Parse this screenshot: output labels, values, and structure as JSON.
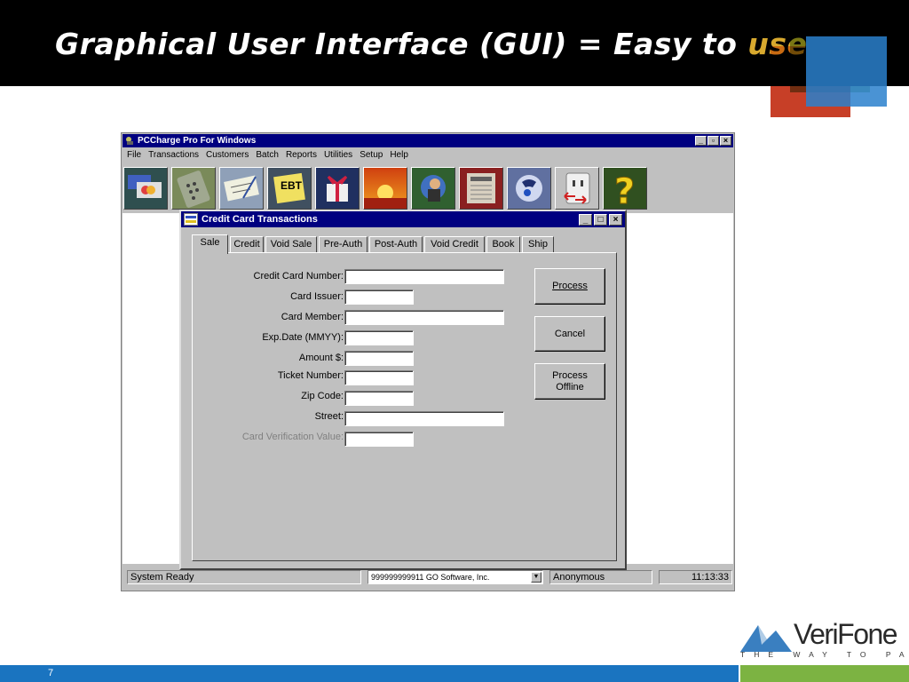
{
  "slide": {
    "title": "Graphical User Interface (GUI) = Easy to use",
    "page_number": "7",
    "logo_text": "VeriFone",
    "logo_tagline": "THE WAY TO PAY™"
  },
  "window": {
    "title": "PCCharge Pro For Windows",
    "menu": [
      "File",
      "Transactions",
      "Customers",
      "Batch",
      "Reports",
      "Utilities",
      "Setup",
      "Help"
    ],
    "toolbar_icons": [
      "credit-cards-icon",
      "calculator-icon",
      "check-icon",
      "ebt-icon",
      "gift-icon",
      "sunset-icon",
      "customer-icon",
      "reports-icon",
      "phone-icon",
      "plug-icon",
      "help-icon"
    ],
    "ebt_label": "EBT",
    "help_glyph": "?"
  },
  "dialog": {
    "title": "Credit Card Transactions",
    "tabs": [
      "Sale",
      "Credit",
      "Void Sale",
      "Pre-Auth",
      "Post-Auth",
      "Void Credit",
      "Book",
      "Ship"
    ],
    "active_tab": "Sale",
    "fields": [
      {
        "label": "Credit Card Number:",
        "value": ""
      },
      {
        "label": "Card Issuer:",
        "value": ""
      },
      {
        "label": "Card Member:",
        "value": ""
      },
      {
        "label": "Exp.Date (MMYY):",
        "value": ""
      },
      {
        "label": "Amount $:",
        "value": ""
      },
      {
        "label": "Ticket Number:",
        "value": ""
      },
      {
        "label": "Zip Code:",
        "value": ""
      },
      {
        "label": "Street:",
        "value": ""
      },
      {
        "label": "Card Verification Value:",
        "value": "",
        "disabled": true
      }
    ],
    "buttons": {
      "process": "Process",
      "cancel": "Cancel",
      "process_offline_line1": "Process",
      "process_offline_line2": "Offline"
    }
  },
  "statusbar": {
    "status": "System Ready",
    "merchant": "999999999911  GO Software, Inc.",
    "user": "Anonymous",
    "time": "11:13:33"
  }
}
